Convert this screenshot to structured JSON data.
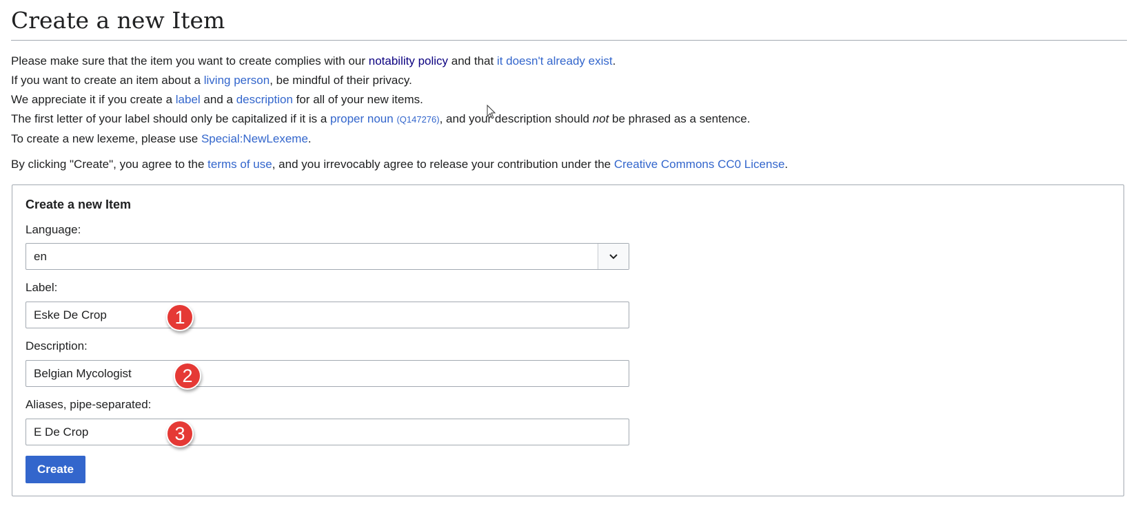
{
  "page_title": "Create a new Item",
  "intro": {
    "line1": {
      "pre": "Please make sure that the item you want to create complies with our ",
      "link1": "notability policy",
      "mid": " and that ",
      "link2": "it doesn't already exist",
      "post": "."
    },
    "line2": {
      "pre": "If you want to create an item about a ",
      "link": "living person",
      "post": ", be mindful of their privacy."
    },
    "line3": {
      "pre": "We appreciate it if you create a ",
      "link1": "label",
      "mid": " and a ",
      "link2": "description",
      "post": " for all of your new items."
    },
    "line4": {
      "pre": "The first letter of your label should only be capitalized if it is a ",
      "link": "proper noun",
      "qid": "(Q147276)",
      "mid": ", and your description should ",
      "em": "not",
      "post": " be phrased as a sentence."
    },
    "line5": {
      "pre": "To create a new lexeme, please use ",
      "link": "Special:NewLexeme",
      "post": "."
    }
  },
  "terms": {
    "pre": "By clicking \"Create\", you agree to the ",
    "link1": "terms of use",
    "mid": ", and you irrevocably agree to release your contribution under the ",
    "link2": "Creative Commons CC0 License",
    "post": "."
  },
  "form": {
    "title": "Create a new Item",
    "language_label": "Language:",
    "language_value": "en",
    "label_label": "Label:",
    "label_value": "Eske De Crop",
    "description_label": "Description:",
    "description_value": "Belgian Mycologist",
    "aliases_label": "Aliases, pipe-separated:",
    "aliases_value": "E De Crop",
    "create_button": "Create"
  },
  "annotations": [
    "1",
    "2",
    "3"
  ],
  "colors": {
    "link": "#3366cc",
    "visited_link": "#0b0080",
    "button": "#3366cc",
    "badge": "#e53935"
  }
}
